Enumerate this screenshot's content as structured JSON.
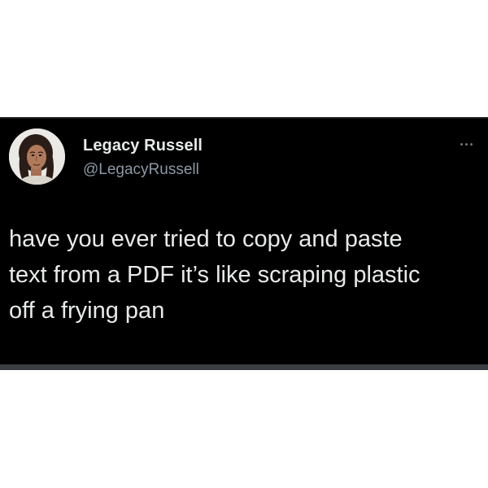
{
  "tweet": {
    "author": {
      "display_name": "Legacy Russell",
      "handle": "@LegacyRussell"
    },
    "text": "have you ever tried to copy and paste\ntext from a PDF it’s like scraping plastic\noff a frying pan",
    "more_icon": "more-horizontal-icon"
  },
  "colors": {
    "card_background": "#000000",
    "page_background": "#ffffff",
    "primary_text": "#e7e9ea",
    "secondary_text": "#8b98a5"
  }
}
